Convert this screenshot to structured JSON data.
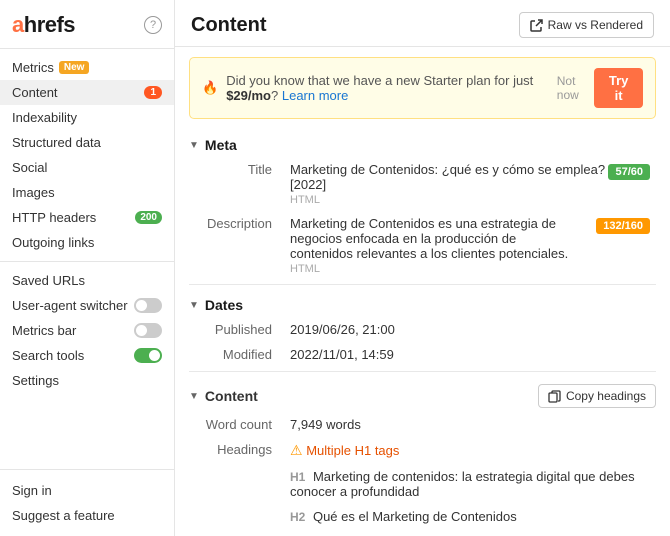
{
  "sidebar": {
    "logo": "ahrefs",
    "help": "?",
    "items": [
      {
        "id": "metrics",
        "label": "Metrics",
        "badge": "New",
        "badgeType": "new"
      },
      {
        "id": "content",
        "label": "Content",
        "badge": "1",
        "badgeType": "num",
        "active": true
      },
      {
        "id": "indexability",
        "label": "Indexability",
        "badge": null
      },
      {
        "id": "structured-data",
        "label": "Structured data",
        "badge": null
      },
      {
        "id": "social",
        "label": "Social",
        "badge": null
      },
      {
        "id": "images",
        "label": "Images",
        "badge": null
      },
      {
        "id": "http-headers",
        "label": "HTTP headers",
        "badge": "200",
        "badgeType": "green"
      },
      {
        "id": "outgoing-links",
        "label": "Outgoing links",
        "badge": null
      }
    ],
    "saved_urls": "Saved URLs",
    "user_agent": "User-agent switcher",
    "metrics_bar": "Metrics bar",
    "search_tools": "Search tools",
    "settings": "Settings",
    "sign_in": "Sign in",
    "suggest": "Suggest a feature"
  },
  "header": {
    "title": "Content",
    "raw_btn": "Raw vs Rendered"
  },
  "banner": {
    "fire_emoji": "🔥",
    "text_before": "Did you know that we have a new Starter plan for just ",
    "price": "$29/mo",
    "text_after": "?",
    "learn_more": "Learn more",
    "not_now": "Not now",
    "try_label": "Try it"
  },
  "meta_section": {
    "label": "Meta",
    "title_label": "Title",
    "title_value": "Marketing de Contenidos: ¿qué es y cómo se emplea? [2022]",
    "title_sub": "HTML",
    "title_count": "57/60",
    "desc_label": "Description",
    "desc_value": "Marketing de Contenidos es una estrategia de negocios enfocada en la producción de contenidos relevantes a los clientes potenciales.",
    "desc_sub": "HTML",
    "desc_count": "132/160"
  },
  "dates_section": {
    "label": "Dates",
    "published_label": "Published",
    "published_value": "2019/06/26, 21:00",
    "modified_label": "Modified",
    "modified_value": "2022/11/01, 14:59"
  },
  "content_section": {
    "label": "Content",
    "copy_btn": "Copy headings",
    "word_count_label": "Word count",
    "word_count_value": "7,949 words",
    "headings_label": "Headings",
    "headings_warning": "Multiple H1 tags",
    "h1_tag": "H1",
    "h1_text": "Marketing de contenidos: la estrategia digital que debes conocer a profundidad",
    "h2_tag": "H2",
    "h2_text": "Qué es el Marketing de Contenidos"
  }
}
